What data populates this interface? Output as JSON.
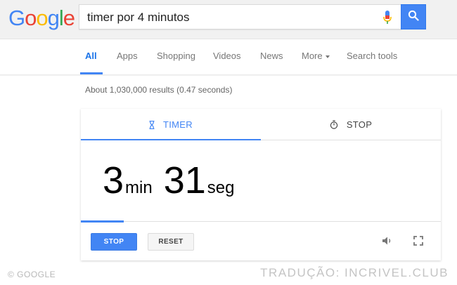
{
  "header": {
    "logo_text": "Google",
    "search_query": "timer por 4 minutos"
  },
  "tabs": [
    {
      "label": "All",
      "active": true
    },
    {
      "label": "Apps"
    },
    {
      "label": "Shopping"
    },
    {
      "label": "Videos"
    },
    {
      "label": "News"
    },
    {
      "label": "More"
    },
    {
      "label": "Search tools"
    }
  ],
  "result_stats": "About 1,030,000 results (0.47 seconds)",
  "timer_card": {
    "tab_timer_label": "TIMER",
    "tab_stop_label": "STOP",
    "minutes": "3",
    "minutes_unit": "min",
    "seconds": "31",
    "seconds_unit": "seg",
    "progress_fraction": 0.12,
    "stop_button_label": "STOP",
    "reset_button_label": "RESET"
  },
  "watermarks": {
    "left": "© GOOGLE",
    "right": "TRADUÇÃO: INCRIVEL.CLUB"
  },
  "colors": {
    "accent": "#4285f4"
  }
}
